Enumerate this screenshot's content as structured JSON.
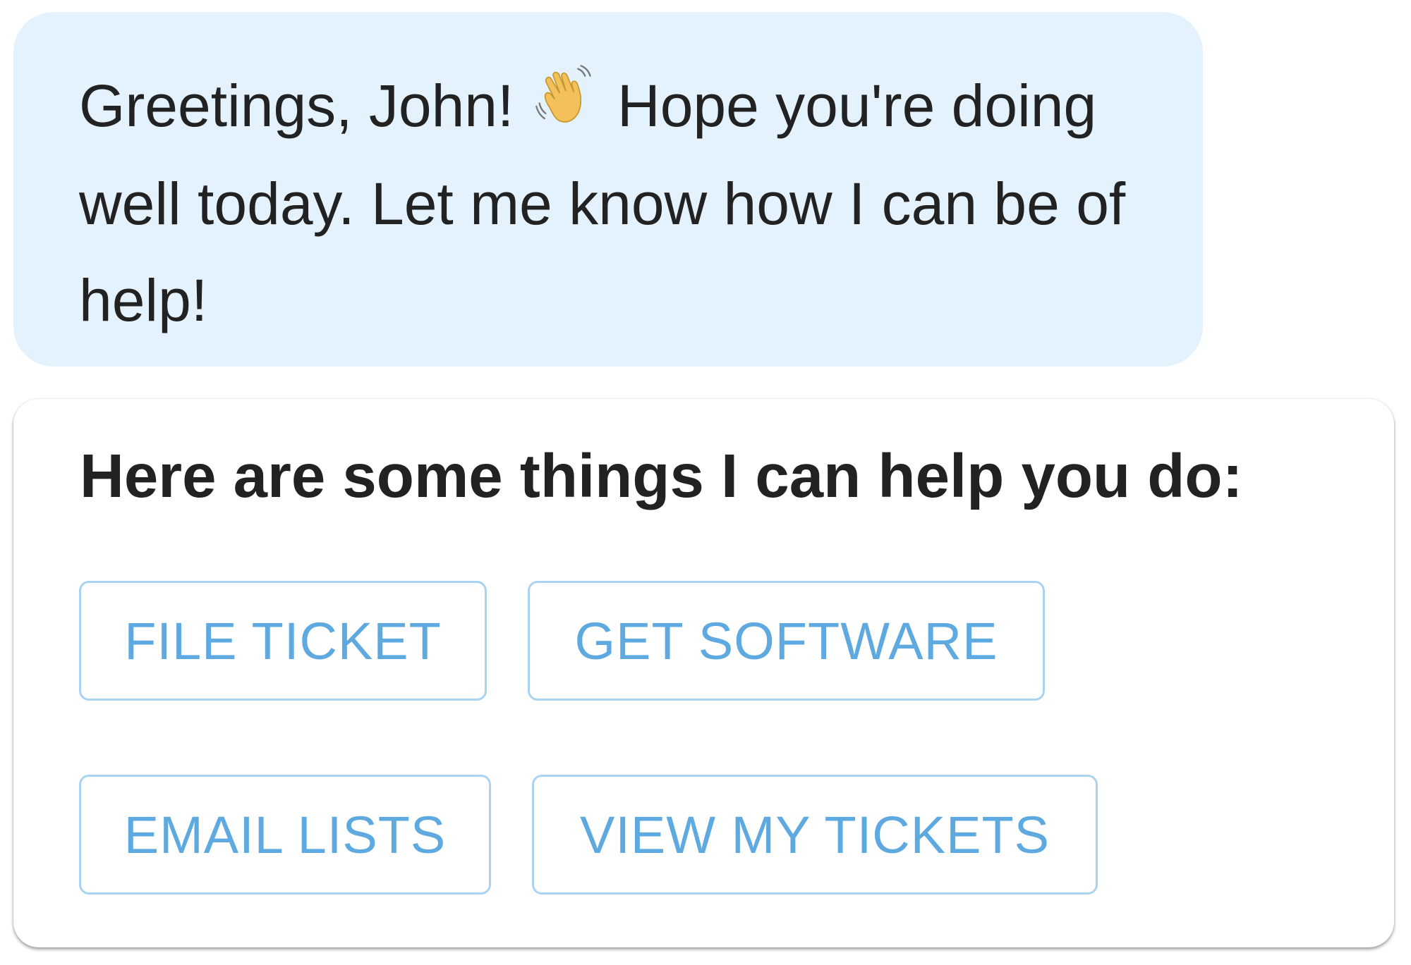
{
  "greeting": {
    "before_icon": "Greetings, John!",
    "icon": "waving-hand-icon",
    "after_icon": "Hope you're doing well today. Let me know how I can be of help!"
  },
  "card": {
    "title": "Here are some things I can help you do:",
    "buttons": [
      {
        "label": "FILE TICKET"
      },
      {
        "label": "GET SOFTWARE"
      },
      {
        "label": "EMAIL LISTS"
      },
      {
        "label": "VIEW MY TICKETS"
      }
    ]
  },
  "colors": {
    "bubble_background": "#e3f2fc",
    "text": "#222222",
    "button_text": "#5ea9e0",
    "button_border": "#a9d3f0"
  }
}
